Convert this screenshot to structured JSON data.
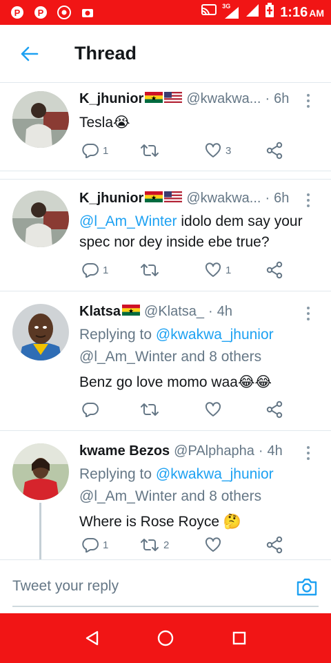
{
  "status_bar": {
    "network": "3G",
    "time": "1:16",
    "ampm": "AM"
  },
  "header": {
    "title": "Thread"
  },
  "tweets": [
    {
      "name": "K_jhunior",
      "flags": [
        "ghana",
        "usa"
      ],
      "handle": "@kwakwa...",
      "time": "6h",
      "text": "Tesla",
      "text_emoji": "😭",
      "replies": "1",
      "retweets": "",
      "likes": "3"
    },
    {
      "name": "K_jhunior",
      "flags": [
        "ghana",
        "usa"
      ],
      "handle": "@kwakwa...",
      "time": "6h",
      "mention": "@l_Am_Winter",
      "text": " idolo dem say your spec nor dey inside ebe true?",
      "replies": "1",
      "retweets": "",
      "likes": "1"
    },
    {
      "name": "Klatsa",
      "flags": [
        "ghana"
      ],
      "handle": "@Klatsa_",
      "time": "4h",
      "replying_prefix": "Replying to ",
      "replying_to": "@kwakwa_jhunior",
      "replying_line2": "@l_Am_Winter and 8 others",
      "text": "Benz go love momo waa",
      "text_emoji": "😂😂",
      "replies": "",
      "retweets": "",
      "likes": ""
    },
    {
      "name": "kwame Bezos",
      "flags": [],
      "handle": "@PAlphapha",
      "time": "4h",
      "replying_prefix": "Replying to ",
      "replying_to": "@kwakwa_jhunior",
      "replying_line2": "@l_Am_Winter and 8 others",
      "text": "Where is Rose Royce ",
      "text_emoji": "🤔",
      "replies": "1",
      "retweets": "2",
      "likes": ""
    }
  ],
  "reply_bar": {
    "placeholder": "Tweet your reply"
  },
  "colors": {
    "accent": "#1da1f2",
    "system_bar": "#f11515",
    "muted": "#657786"
  }
}
